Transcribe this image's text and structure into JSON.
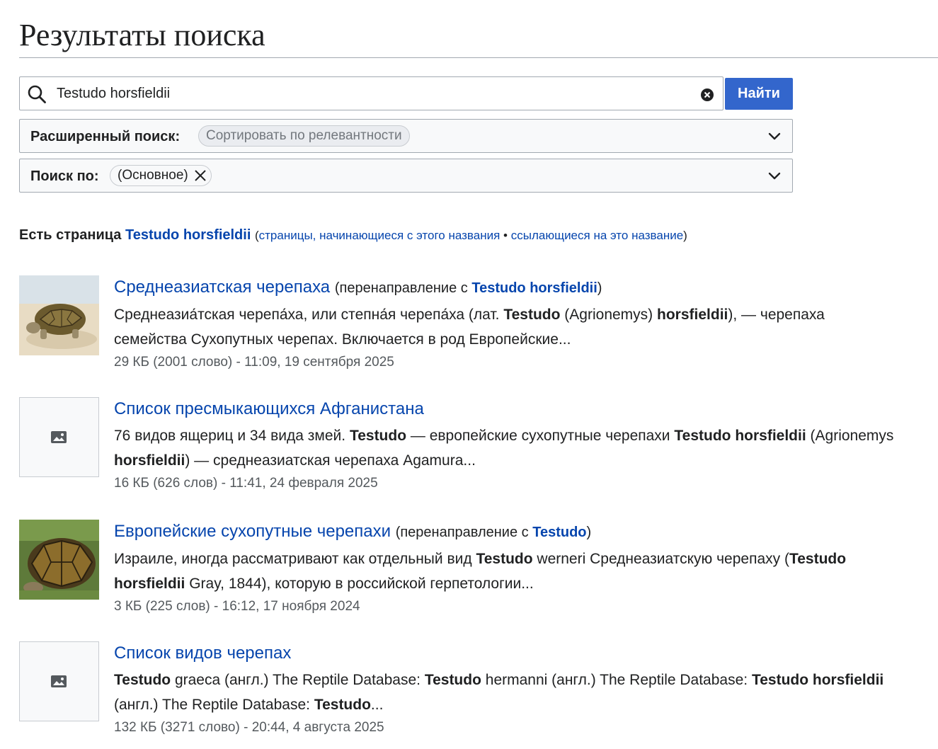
{
  "page": {
    "title": "Результаты поиска"
  },
  "search": {
    "value": "Testudo horsfieldii",
    "button_label": "Найти"
  },
  "advanced": {
    "label": "Расширенный поиск:",
    "chip": "Сортировать по релевантности"
  },
  "namespace": {
    "label": "Поиск по:",
    "chip": "(Основное)"
  },
  "exact_match": {
    "lead": "Есть страница",
    "title": "Testudo horsfieldii",
    "open_paren": "(",
    "prefix_link": "страницы, начинающиеся с этого названия",
    "separator": "•",
    "backlinks_link": "ссылающиеся на это название",
    "close_paren": ")"
  },
  "results": [
    {
      "title": "Среднеазиатская черепаха",
      "redirect_prefix": "(перенаправление с",
      "redirect_target": "Testudo horsfieldii",
      "redirect_suffix": ")",
      "snippet": {
        "l1": "Среднеазиа́тская черепа́ха, или степна́я черепа́ха (лат.",
        "b1": "Testudo",
        "l2": "(Agrionemys)",
        "b2": "horsfieldii",
        "l3": "), — черепаха семейства Сухопутных черепах. Включается в род Европейские..."
      },
      "meta": "29 КБ (2001 слово) - 11:09, 19 сентября 2025"
    },
    {
      "title": "Список пресмыкающихся Афганистана",
      "snippet": {
        "l1": "76 видов ящериц и 34 вида змей.",
        "b1": "Testudo",
        "l2": "— европейские сухопутные черепахи",
        "b2": "Testudo horsfieldii",
        "l3": "(Agrionemys",
        "b3": "horsfieldii",
        "l4": ") — среднеазиатская черепаха Agamura..."
      },
      "meta": "16 КБ (626 слов) - 11:41, 24 февраля 2025"
    },
    {
      "title": "Европейские сухопутные черепахи",
      "redirect_prefix": "(перенаправление с",
      "redirect_target": "Testudo",
      "redirect_suffix": ")",
      "snippet": {
        "l1": "Израиле, иногда рассматривают как отдельный вид",
        "b1": "Testudo",
        "l2": "werneri Среднеазиатскую черепаху (",
        "b2": "Testudo horsfieldii",
        "l3": "Gray, 1844), которую в российской герпетологии..."
      },
      "meta": "3 КБ (225 слов) - 16:12, 17 ноября 2024"
    },
    {
      "title": "Список видов черепах",
      "snippet": {
        "b1": "Testudo",
        "l1": "graeca (англ.) The Reptile Database:",
        "b2": "Testudo",
        "l2": "hermanni (англ.) The Reptile Database:",
        "b3": "Testudo horsfieldii",
        "l3": "(англ.) The Reptile Database:",
        "b4": "Testudo",
        "l4": "..."
      },
      "meta": "132 КБ (3271 слово) - 20:44, 4 августа 2025"
    }
  ],
  "colors": {
    "link": "#0645ad",
    "button": "#3366cc",
    "meta": "#54595d",
    "border": "#a2a9b1"
  }
}
